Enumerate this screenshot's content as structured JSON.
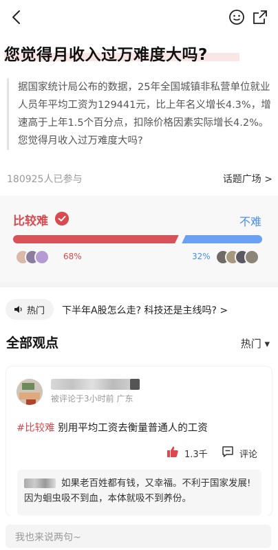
{
  "header": {
    "back_icon": "chevron-left-icon",
    "face_icon": "emoji-face-icon",
    "share_icon": "share-icon"
  },
  "question": {
    "title": "您觉得月收入过万难度大吗?",
    "description": "据国家统计局公布的数据，25年全国城镇非私营单位就业人员年平均工资为129441元，比上年名义增长4.3%，增速高于上年1.5个百分点，扣除价格因素实际增长4.2%。您觉得月收入过万难度大吗?"
  },
  "meta": {
    "participants": "180925人已参与",
    "topic_link": "话题广场 >"
  },
  "vote": {
    "left_option": "比较难",
    "right_option": "不难",
    "left_percent_label": "68%",
    "right_percent_label": "32%",
    "left_percent": 68,
    "right_percent": 32,
    "left_color": "#d84a4f",
    "right_color": "#4a8cf0"
  },
  "hot": {
    "label": "热门",
    "text": "下半年A股怎么走? 科技还是主线吗? >"
  },
  "section": {
    "title": "全部观点",
    "sort": "热门 ▾"
  },
  "comment": {
    "meta": "被评论于3小时前 广东",
    "tag": "#比较难",
    "body": " 别用平均工资去衡量普通人的工资",
    "likes": "1.3千",
    "reply_label": "评论",
    "sub_reply": "如果老百姓都有钱，又幸福。不利于国家发展! 因为蛔虫吸不到血，本体就吸不到养份。"
  },
  "input": {
    "placeholder": "我也来说两句~"
  }
}
